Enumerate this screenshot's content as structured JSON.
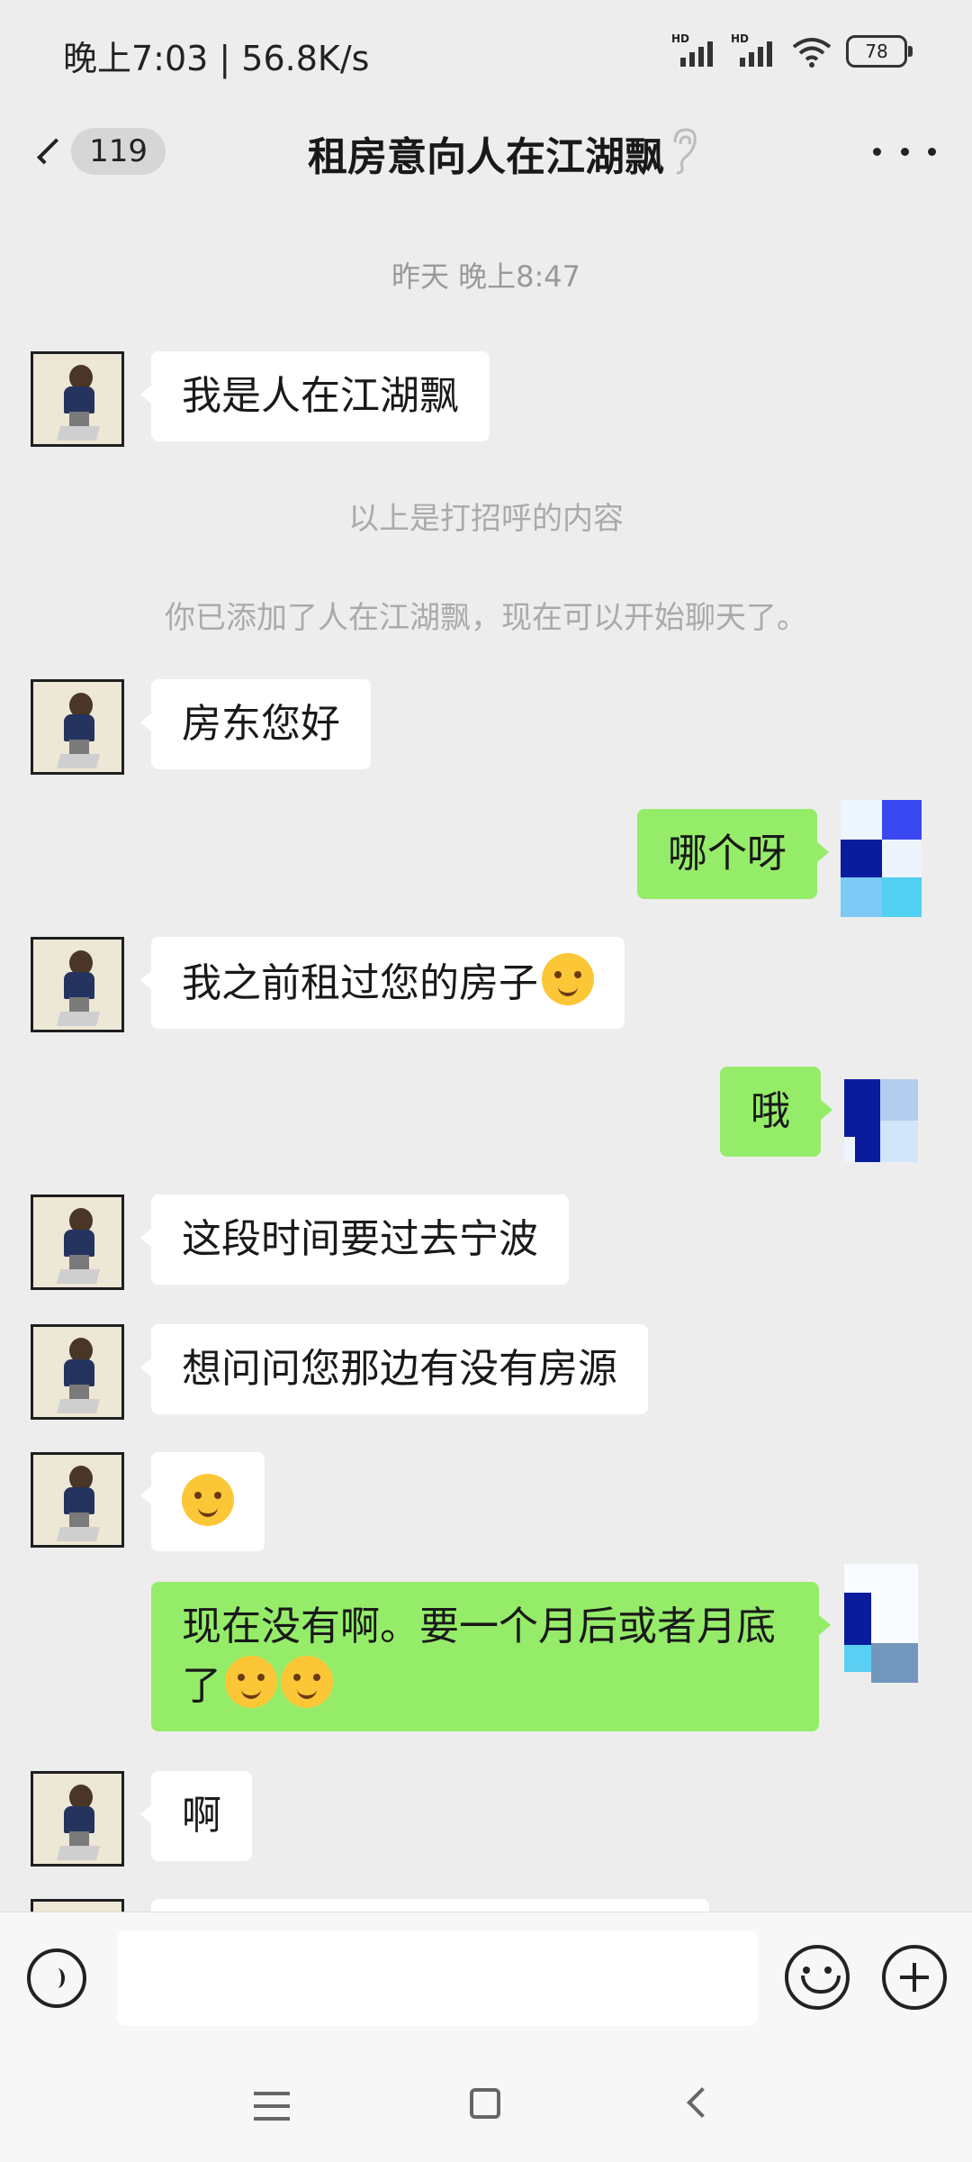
{
  "status": {
    "time": "晚上7:03 | 56.8K/s",
    "battery": "78"
  },
  "header": {
    "unread_count": "119",
    "title": "租房意向人在江湖飘"
  },
  "chat": {
    "timestamp": "昨天 晚上8:47",
    "notes": [
      "以上是打招呼的内容",
      "你已添加了人在江湖飘，现在可以开始聊天了。"
    ],
    "messages": [
      {
        "from": "other",
        "text": "我是人在江湖飘"
      },
      {
        "from": "other",
        "text": "房东您好"
      },
      {
        "from": "self",
        "text": "哪个呀"
      },
      {
        "from": "other",
        "text": "我之前租过您的房子",
        "emoji": "crying-laughing-emoji"
      },
      {
        "from": "self",
        "text": "哦"
      },
      {
        "from": "other",
        "text": "这段时间要过去宁波"
      },
      {
        "from": "other",
        "text": "想问问您那边有没有房源"
      },
      {
        "from": "other",
        "text": "",
        "emoji": "thinking-emoji"
      },
      {
        "from": "self",
        "text": "现在没有啊。要一个月后或者月底了",
        "emoji": "smirk-emoji, giggle-emoji"
      },
      {
        "from": "other",
        "text": "啊"
      }
    ]
  },
  "colors": {
    "self_bubble": "#95ec69",
    "other_bubble": "#ffffff",
    "background": "#ededed"
  }
}
